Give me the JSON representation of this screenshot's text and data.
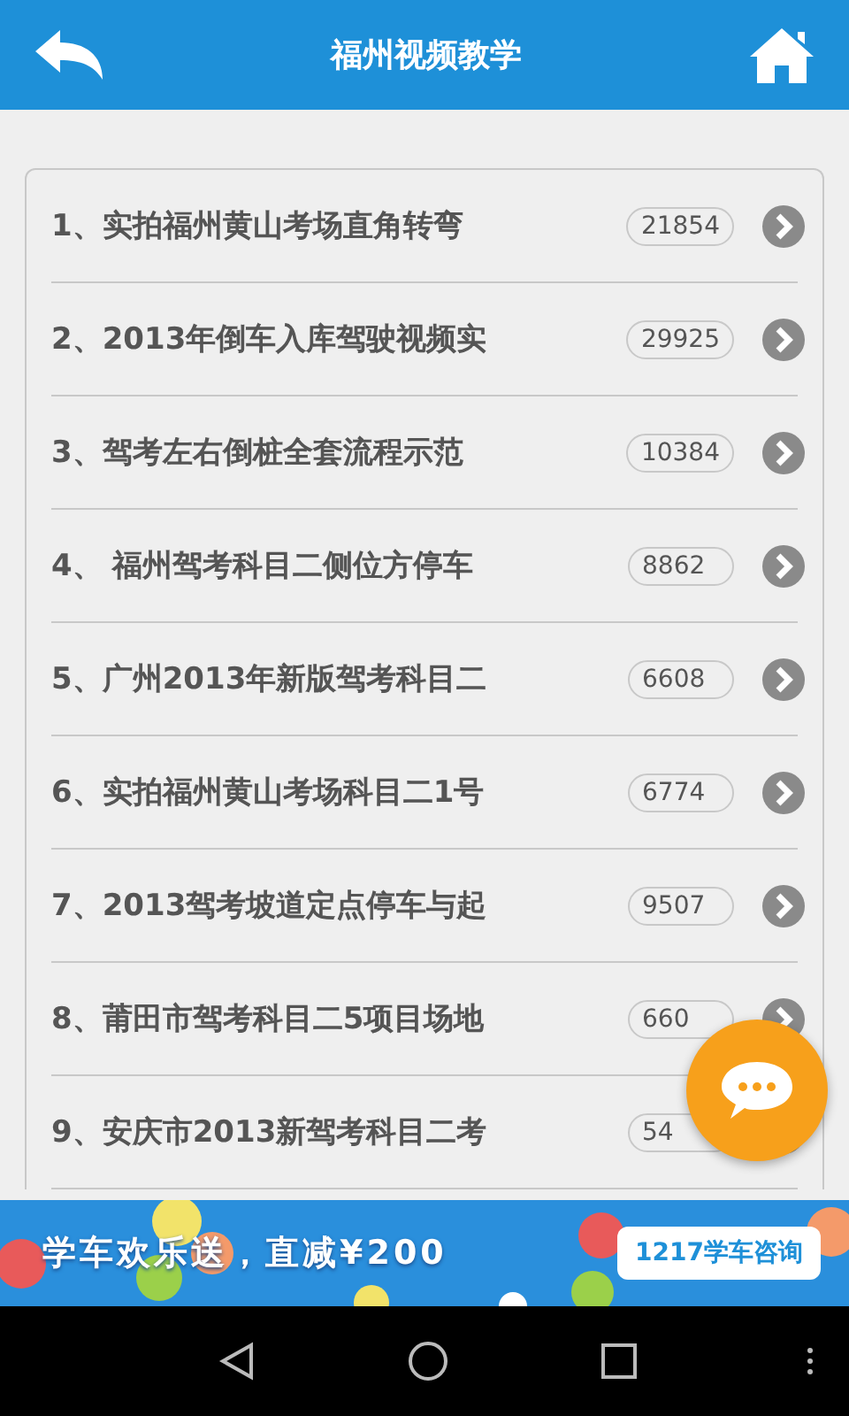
{
  "header": {
    "title": "福州视频教学"
  },
  "videos": [
    {
      "title": "1、实拍福州黄山考场直角转弯",
      "count": "21854"
    },
    {
      "title": "2、2013年倒车入库驾驶视频实",
      "count": "29925"
    },
    {
      "title": "3、驾考左右倒桩全套流程示范",
      "count": "10384"
    },
    {
      "title": "4、 福州驾考科目二侧位方停车",
      "count": "8862"
    },
    {
      "title": "5、广州2013年新版驾考科目二",
      "count": "6608"
    },
    {
      "title": "6、实拍福州黄山考场科目二1号",
      "count": "6774"
    },
    {
      "title": "7、2013驾考坡道定点停车与起",
      "count": "9507"
    },
    {
      "title": "8、莆田市驾考科目二5项目场地",
      "count": "660"
    },
    {
      "title": "9、安庆市2013新驾考科目二考",
      "count": "54"
    }
  ],
  "banner": {
    "kind": "picture",
    "slogan": "学车欢乐送，直减¥200",
    "button": "1217学车咨询"
  }
}
